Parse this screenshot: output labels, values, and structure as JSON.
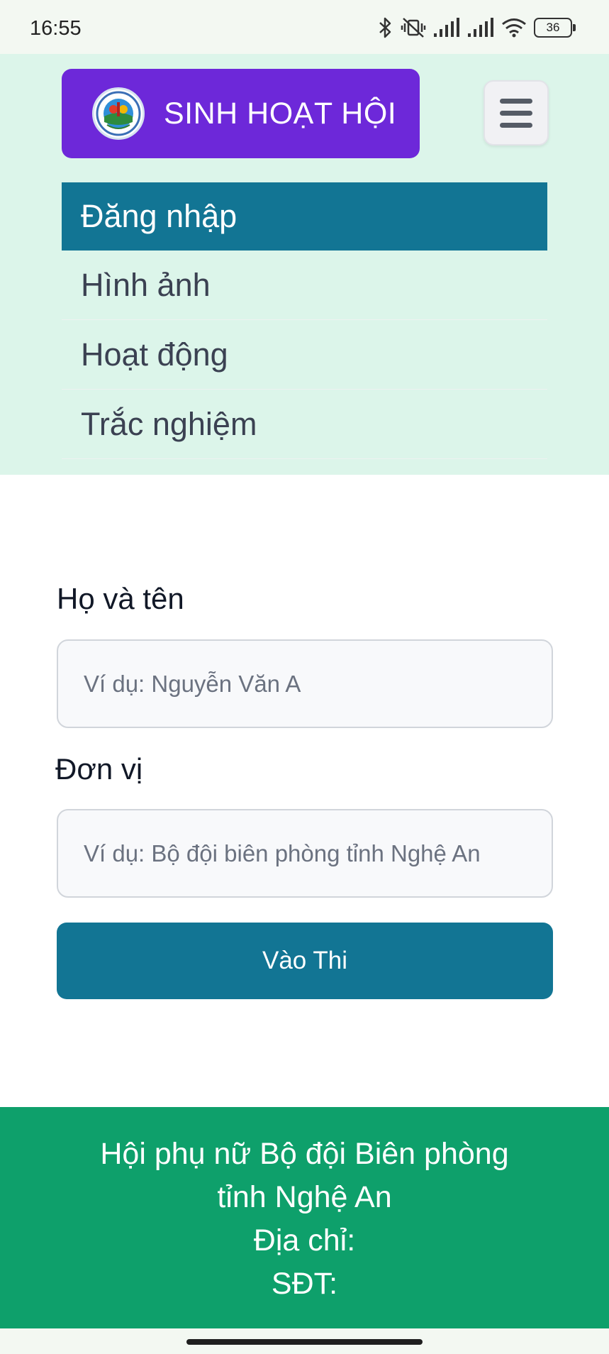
{
  "status_bar": {
    "time": "16:55",
    "battery": "36",
    "icons": [
      "bluetooth-icon",
      "silent-vibrate-icon",
      "signal-icon",
      "signal-icon",
      "wifi-icon",
      "battery-icon"
    ]
  },
  "brand": {
    "title": "SINH HOẠT HỘI",
    "logo_icon": "border-guard-women-emblem"
  },
  "nav": {
    "items": [
      {
        "label": "Đăng nhập",
        "active": true
      },
      {
        "label": "Hình ảnh",
        "active": false
      },
      {
        "label": "Hoạt động",
        "active": false
      },
      {
        "label": "Trắc nghiệm",
        "active": false
      }
    ]
  },
  "form": {
    "name_label": "Họ và tên",
    "name_placeholder": "Ví dụ: Nguyễn Văn A",
    "unit_label": "Đơn vị",
    "unit_placeholder": "Ví dụ: Bộ đội biên phòng tỉnh Nghệ An",
    "submit_label": "Vào Thi"
  },
  "footer": {
    "line1": "Hội phụ nữ Bộ đội Biên phòng",
    "line2": "tỉnh Nghệ An",
    "line3": "Địa chỉ:",
    "line4": "SĐT:"
  },
  "colors": {
    "brand": "#6d28d9",
    "primary": "#127594",
    "footer": "#0ea06b",
    "header_bg": "#dcf5ea"
  }
}
